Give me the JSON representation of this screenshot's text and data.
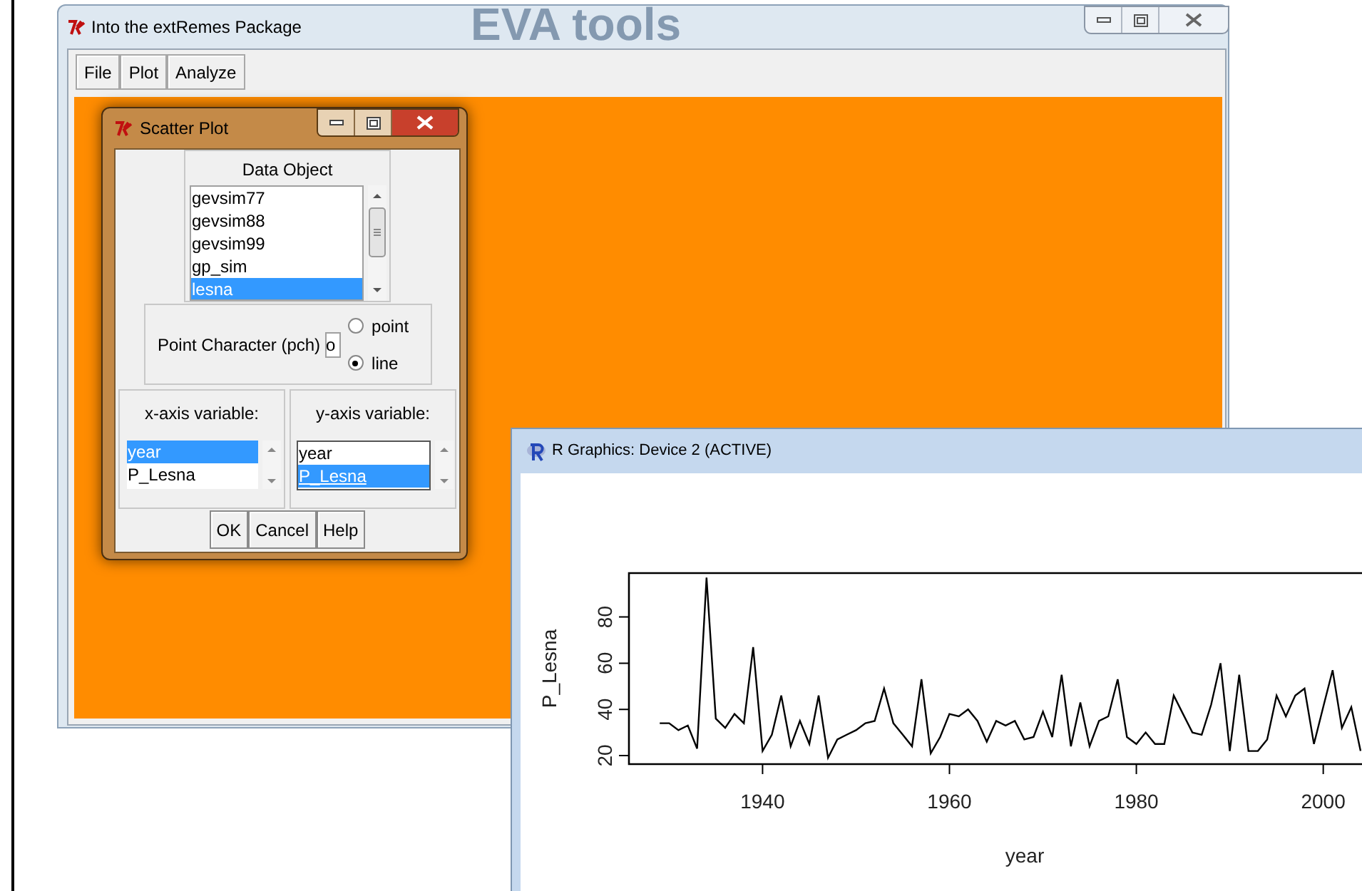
{
  "backdrop": {
    "heading": "EVA tools"
  },
  "main_window": {
    "title": "Into the extRemes Package",
    "menu": [
      {
        "label": "File"
      },
      {
        "label": "Plot"
      },
      {
        "label": "Analyze"
      }
    ]
  },
  "dialog": {
    "title": "Scatter Plot",
    "data_object": {
      "label": "Data Object",
      "items": [
        {
          "label": "gevsim77",
          "selected": false
        },
        {
          "label": "gevsim88",
          "selected": false
        },
        {
          "label": "gevsim99",
          "selected": false
        },
        {
          "label": "gp_sim",
          "selected": false
        },
        {
          "label": "lesna",
          "selected": true
        }
      ]
    },
    "pch": {
      "label": "Point Character (pch)",
      "value": "o",
      "options": [
        {
          "label": "point",
          "selected": false
        },
        {
          "label": "line",
          "selected": true
        }
      ]
    },
    "x_axis": {
      "label": "x-axis variable:",
      "items": [
        {
          "label": "year",
          "selected": true
        },
        {
          "label": "P_Lesna",
          "selected": false
        }
      ]
    },
    "y_axis": {
      "label": "y-axis variable:",
      "items": [
        {
          "label": "year",
          "selected": false
        },
        {
          "label": "P_Lesna",
          "selected": true
        }
      ]
    },
    "buttons": [
      "OK",
      "Cancel",
      "Help"
    ]
  },
  "graphics_window": {
    "title": "R Graphics: Device 2 (ACTIVE)",
    "chart_data": {
      "type": "line",
      "xlabel": "year",
      "ylabel": "P_Lesna",
      "x": [
        1929,
        1930,
        1931,
        1932,
        1933,
        1934,
        1935,
        1936,
        1937,
        1938,
        1939,
        1940,
        1941,
        1942,
        1943,
        1944,
        1945,
        1946,
        1947,
        1948,
        1949,
        1950,
        1951,
        1952,
        1953,
        1954,
        1955,
        1956,
        1957,
        1958,
        1959,
        1960,
        1961,
        1962,
        1963,
        1964,
        1965,
        1966,
        1967,
        1968,
        1969,
        1970,
        1971,
        1972,
        1973,
        1974,
        1975,
        1976,
        1977,
        1978,
        1979,
        1980,
        1981,
        1982,
        1983,
        1984,
        1985,
        1986,
        1987,
        1988,
        1989,
        1990,
        1991,
        1992,
        1993,
        1994,
        1995,
        1996,
        1997,
        1998,
        1999,
        2000,
        2001,
        2002,
        2003,
        2004
      ],
      "series": [
        {
          "color": "#000000",
          "values": [
            34,
            34,
            31,
            33,
            23,
            97,
            36,
            32,
            38,
            34,
            67,
            22,
            29,
            46,
            24,
            35,
            25,
            46,
            19,
            27,
            29,
            31,
            34,
            35,
            49,
            34,
            29,
            24,
            53,
            21,
            28,
            38,
            37,
            40,
            35,
            26,
            35,
            33,
            35,
            27,
            28,
            39,
            28,
            55,
            24,
            43,
            24,
            35,
            37,
            53,
            28,
            25,
            30,
            25,
            25,
            46,
            38,
            30,
            29,
            42,
            60,
            22,
            55,
            22,
            22,
            27,
            46,
            37,
            46,
            49,
            25,
            41,
            57,
            32,
            41,
            22
          ]
        }
      ],
      "xlim": [
        1925.7,
        2004.3
      ],
      "ylim": [
        16.3,
        99
      ],
      "xticks": [
        1940,
        1960,
        1980,
        2000
      ],
      "yticks": [
        20,
        40,
        60,
        80
      ]
    }
  }
}
